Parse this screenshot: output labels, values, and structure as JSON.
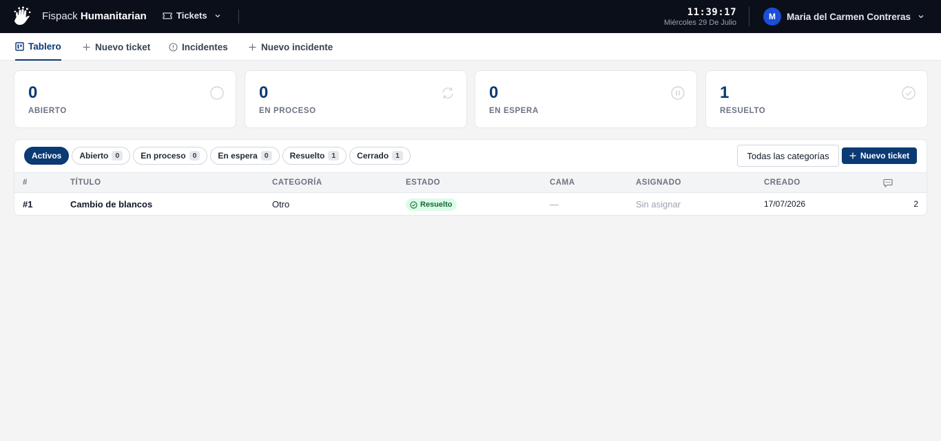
{
  "topbar": {
    "brand_light": "Fispack",
    "brand_bold": "Humanitarian",
    "module_label": "Tickets",
    "clock_time": "11:39:17",
    "clock_date": "Miércoles 29 De Julio",
    "user_initial": "M",
    "user_name": "Maria del Carmen Contreras"
  },
  "nav": {
    "tabs": [
      {
        "label": "Tablero",
        "icon": "board-icon",
        "active": true
      },
      {
        "label": "Nuevo ticket",
        "icon": "plus-icon"
      },
      {
        "label": "Incidentes",
        "icon": "info-icon"
      },
      {
        "label": "Nuevo incidente",
        "icon": "plus-icon"
      }
    ]
  },
  "stats": [
    {
      "value": "0",
      "label": "ABIERTO",
      "icon": "circle-icon"
    },
    {
      "value": "0",
      "label": "EN PROCESO",
      "icon": "refresh-icon"
    },
    {
      "value": "0",
      "label": "EN ESPERA",
      "icon": "pause-icon"
    },
    {
      "value": "1",
      "label": "RESUELTO",
      "icon": "check-circle-icon"
    }
  ],
  "filters": [
    {
      "label": "Activos",
      "active": true
    },
    {
      "label": "Abierto",
      "count": "0"
    },
    {
      "label": "En proceso",
      "count": "0"
    },
    {
      "label": "En espera",
      "count": "0"
    },
    {
      "label": "Resuelto",
      "count": "1"
    },
    {
      "label": "Cerrado",
      "count": "1"
    }
  ],
  "category_select": "Todas las categorías",
  "new_ticket_button": "Nuevo ticket",
  "table": {
    "headers": {
      "id": "#",
      "title": "TÍTULO",
      "category": "CATEGORÍA",
      "status": "ESTADO",
      "bed": "CAMA",
      "assigned": "ASIGNADO",
      "created": "CREADO",
      "comments_icon": "comment-icon"
    },
    "rows": [
      {
        "id": "#1",
        "title": "Cambio de blancos",
        "category": "Otro",
        "status": "Resuelto",
        "bed": "—",
        "assigned": "Sin asignar",
        "created": "17/07/2026",
        "comments": "2"
      }
    ]
  },
  "colors": {
    "topbar_bg": "#0b0f1a",
    "primary": "#0b3a75",
    "success_bg": "#dcfce7",
    "success_fg": "#166534"
  }
}
